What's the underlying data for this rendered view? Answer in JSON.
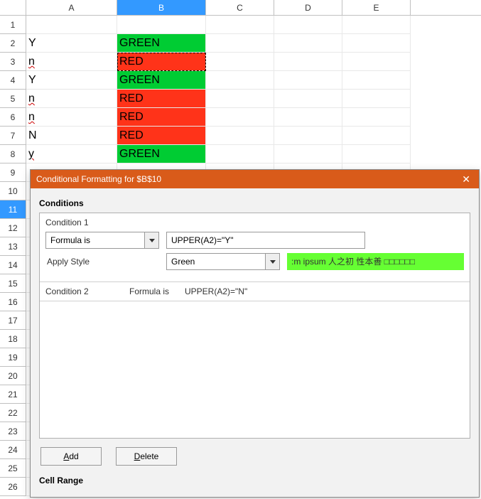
{
  "columns": [
    "A",
    "B",
    "C",
    "D",
    "E"
  ],
  "selected_column": "B",
  "selected_row": 11,
  "rows": [
    1,
    2,
    3,
    4,
    5,
    6,
    7,
    8,
    9,
    10,
    11,
    12,
    13,
    14,
    15,
    16,
    17,
    18,
    19,
    20,
    21,
    22,
    23,
    24,
    25,
    26
  ],
  "cells": {
    "A2": {
      "v": "Y"
    },
    "A3": {
      "v": "n",
      "squiggle": true
    },
    "A4": {
      "v": "Y"
    },
    "A5": {
      "v": "n",
      "squiggle": true
    },
    "A6": {
      "v": "n",
      "squiggle": true
    },
    "A7": {
      "v": "N"
    },
    "A8": {
      "v": "y",
      "squiggle": true
    },
    "B2": {
      "v": "GREEN",
      "fmt": "green"
    },
    "B3": {
      "v": "RED",
      "fmt": "red",
      "ants": true
    },
    "B4": {
      "v": "GREEN",
      "fmt": "green"
    },
    "B5": {
      "v": "RED",
      "fmt": "red"
    },
    "B6": {
      "v": "RED",
      "fmt": "red"
    },
    "B7": {
      "v": "RED",
      "fmt": "red"
    },
    "B8": {
      "v": "GREEN",
      "fmt": "green"
    }
  },
  "dialog": {
    "title": "Conditional Formatting for $B$10",
    "conditions_label": "Conditions",
    "cond1": {
      "title": "Condition 1",
      "type_label": "Formula is",
      "formula": "UPPER(A2)=\"Y\"",
      "apply_style_label": "Apply Style",
      "style_name": "Green",
      "preview": ":m ipsum   人之初 性本善   □□□□□□"
    },
    "cond2": {
      "title": "Condition 2",
      "type_label": "Formula is",
      "formula": "UPPER(A2)=\"N\""
    },
    "add_btn": {
      "pre": "",
      "ul": "A",
      "post": "dd"
    },
    "delete_btn": {
      "pre": "",
      "ul": "D",
      "post": "elete"
    },
    "cell_range_label": "Cell Range"
  }
}
